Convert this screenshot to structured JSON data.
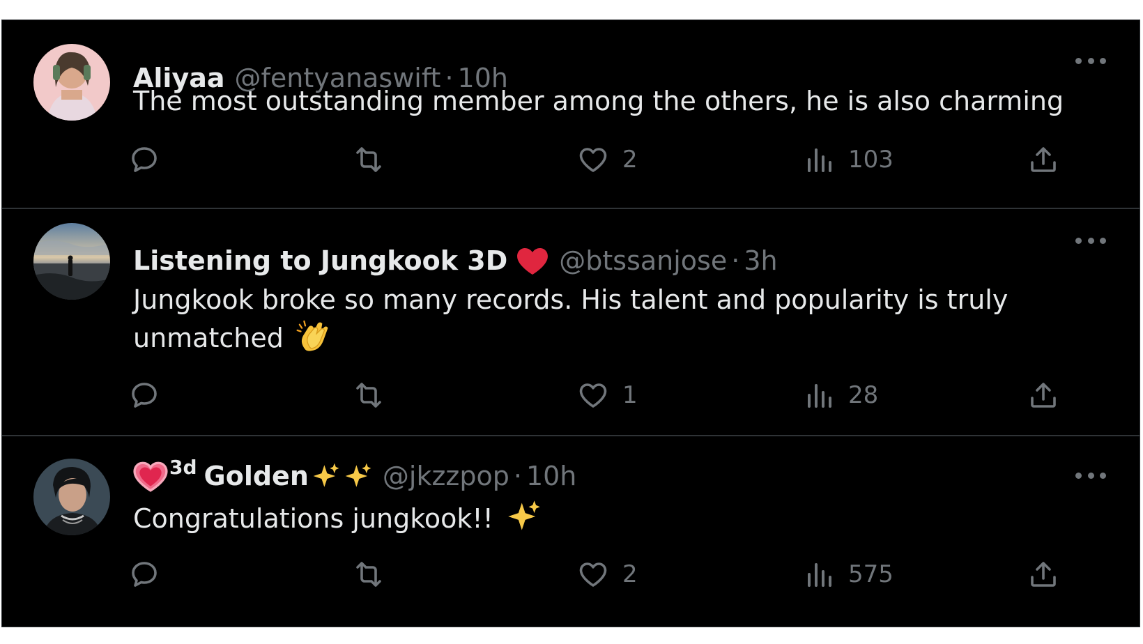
{
  "tweets": [
    {
      "name": "Aliyaa",
      "handle": "@fentyanaswift",
      "separator": "·",
      "time": "10h",
      "text": "The most outstanding member among the others, he is also charming",
      "likes": "2",
      "views": "103",
      "avatar_icon": "avatar-pink-portrait"
    },
    {
      "name": "Listening to Jungkook 3D",
      "name_emoji": "red-heart-icon",
      "handle": "@btssanjose",
      "separator": "·",
      "time": "3h",
      "text": "Jungkook broke so many records. His talent and popularity is truly unmatched",
      "text_emoji": "clapping-hands-icon",
      "likes": "1",
      "views": "28",
      "avatar_icon": "avatar-beach-sunset"
    },
    {
      "name_prefix_emoji": "pink-heart-icon",
      "name_sup": "3d",
      "name": "Golden",
      "name_emojis": [
        "sparkles-icon",
        "sparkles-icon"
      ],
      "handle": "@jkzzpop",
      "separator": "·",
      "time": "10h",
      "text": "Congratulations jungkook!!",
      "text_emoji": "sparkles-icon",
      "likes": "2",
      "views": "575",
      "avatar_icon": "avatar-dark-portrait"
    }
  ],
  "colors": {
    "background": "#000000",
    "text_primary": "#e7e9ea",
    "text_secondary": "#71767b",
    "divider": "#2f3336"
  }
}
